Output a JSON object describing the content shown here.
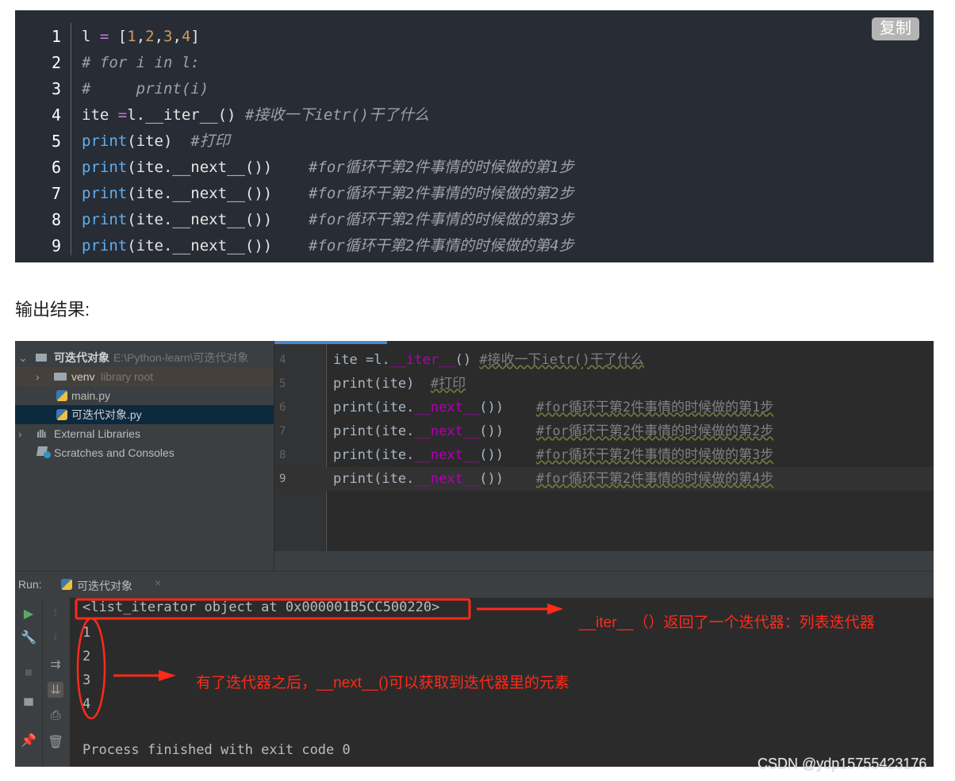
{
  "code_block": {
    "copy_label": "复制",
    "lines": [
      {
        "num": "1",
        "parts": [
          {
            "t": "l ",
            "c": ""
          },
          {
            "t": "= ",
            "c": "op"
          },
          {
            "t": "[",
            "c": ""
          },
          {
            "t": "1",
            "c": "num"
          },
          {
            "t": ",",
            "c": ""
          },
          {
            "t": "2",
            "c": "num"
          },
          {
            "t": ",",
            "c": ""
          },
          {
            "t": "3",
            "c": "num"
          },
          {
            "t": ",",
            "c": ""
          },
          {
            "t": "4",
            "c": "num"
          },
          {
            "t": "]",
            "c": ""
          }
        ]
      },
      {
        "num": "2",
        "parts": [
          {
            "t": "# for i in l:",
            "c": "cm"
          }
        ]
      },
      {
        "num": "3",
        "parts": [
          {
            "t": "#     print(i)",
            "c": "cm"
          }
        ]
      },
      {
        "num": "4",
        "parts": [
          {
            "t": "ite ",
            "c": ""
          },
          {
            "t": "=",
            "c": "op"
          },
          {
            "t": "l.__iter__() ",
            "c": ""
          },
          {
            "t": "#接收一下ietr()干了什么",
            "c": "cm"
          }
        ]
      },
      {
        "num": "5",
        "parts": [
          {
            "t": "print",
            "c": "fn"
          },
          {
            "t": "(ite)  ",
            "c": ""
          },
          {
            "t": "#打印",
            "c": "cm"
          }
        ]
      },
      {
        "num": "6",
        "parts": [
          {
            "t": "print",
            "c": "fn"
          },
          {
            "t": "(ite.__next__())    ",
            "c": ""
          },
          {
            "t": "#for循环干第2件事情的时候做的第1步",
            "c": "cm"
          }
        ]
      },
      {
        "num": "7",
        "parts": [
          {
            "t": "print",
            "c": "fn"
          },
          {
            "t": "(ite.__next__())    ",
            "c": ""
          },
          {
            "t": "#for循环干第2件事情的时候做的第2步",
            "c": "cm"
          }
        ]
      },
      {
        "num": "8",
        "parts": [
          {
            "t": "print",
            "c": "fn"
          },
          {
            "t": "(ite.__next__())    ",
            "c": ""
          },
          {
            "t": "#for循环干第2件事情的时候做的第3步",
            "c": "cm"
          }
        ]
      },
      {
        "num": "9",
        "parts": [
          {
            "t": "print",
            "c": "fn"
          },
          {
            "t": "(ite.__next__())    ",
            "c": ""
          },
          {
            "t": "#for循环干第2件事情的时候做的第4步",
            "c": "cm"
          }
        ]
      }
    ]
  },
  "output_label": "输出结果:",
  "project": {
    "root_name": "可迭代对象",
    "root_path": "E:\\Python-learn\\可迭代对象",
    "venv_name": "venv",
    "venv_note": "library root",
    "file1": "main.py",
    "file2": "可迭代对象.py",
    "external": "External Libraries",
    "scratches": "Scratches and Consoles"
  },
  "editor": {
    "lines": [
      {
        "num": "4",
        "parts": [
          {
            "t": "ite ",
            "c": ""
          },
          {
            "t": "=",
            "c": ""
          },
          {
            "t": "l.",
            "c": ""
          },
          {
            "t": "__iter__",
            "c": "purple"
          },
          {
            "t": "() ",
            "c": ""
          },
          {
            "t": "#接收一下ietr()干了什么",
            "c": "ecm"
          }
        ]
      },
      {
        "num": "5",
        "parts": [
          {
            "t": "print(ite)  ",
            "c": ""
          },
          {
            "t": "#打印",
            "c": "ecm"
          }
        ]
      },
      {
        "num": "6",
        "parts": [
          {
            "t": "print(ite.",
            "c": ""
          },
          {
            "t": "__next__",
            "c": "purple"
          },
          {
            "t": "())    ",
            "c": ""
          },
          {
            "t": "#for循环干第2件事情的时候做的第1步",
            "c": "ecm"
          }
        ]
      },
      {
        "num": "7",
        "parts": [
          {
            "t": "print(ite.",
            "c": ""
          },
          {
            "t": "__next__",
            "c": "purple"
          },
          {
            "t": "())    ",
            "c": ""
          },
          {
            "t": "#for循环干第2件事情的时候做的第2步",
            "c": "ecm"
          }
        ]
      },
      {
        "num": "8",
        "parts": [
          {
            "t": "print(ite.",
            "c": ""
          },
          {
            "t": "__next__",
            "c": "purple"
          },
          {
            "t": "())    ",
            "c": ""
          },
          {
            "t": "#for循环干第2件事情的时候做的第3步",
            "c": "ecm"
          }
        ]
      },
      {
        "num": "9",
        "parts": [
          {
            "t": "print(ite.",
            "c": ""
          },
          {
            "t": "__next__",
            "c": "purple"
          },
          {
            "t": "())    ",
            "c": ""
          },
          {
            "t": "#for循环干第2件事情的时候做的第4步",
            "c": "ecm"
          }
        ]
      }
    ]
  },
  "run": {
    "label": "Run:",
    "tab_label": "可迭代对象",
    "tab_close": "×"
  },
  "console": {
    "iterator_line": "<list_iterator object at 0x000001B5CC500220>",
    "values": [
      "1",
      "2",
      "3",
      "4"
    ],
    "finish_line": "Process finished with exit code 0"
  },
  "annotations": {
    "iter_note": "__iter__（）返回了一个迭代器：列表迭代器",
    "next_note": "有了迭代器之后，__next__()可以获取到迭代器里的元素"
  },
  "watermark": "CSDN @ydp15755423176",
  "colors": {
    "annotation_red": "#ff2a1a",
    "code_bg": "#282c34",
    "ide_bg": "#2b2b2b"
  }
}
